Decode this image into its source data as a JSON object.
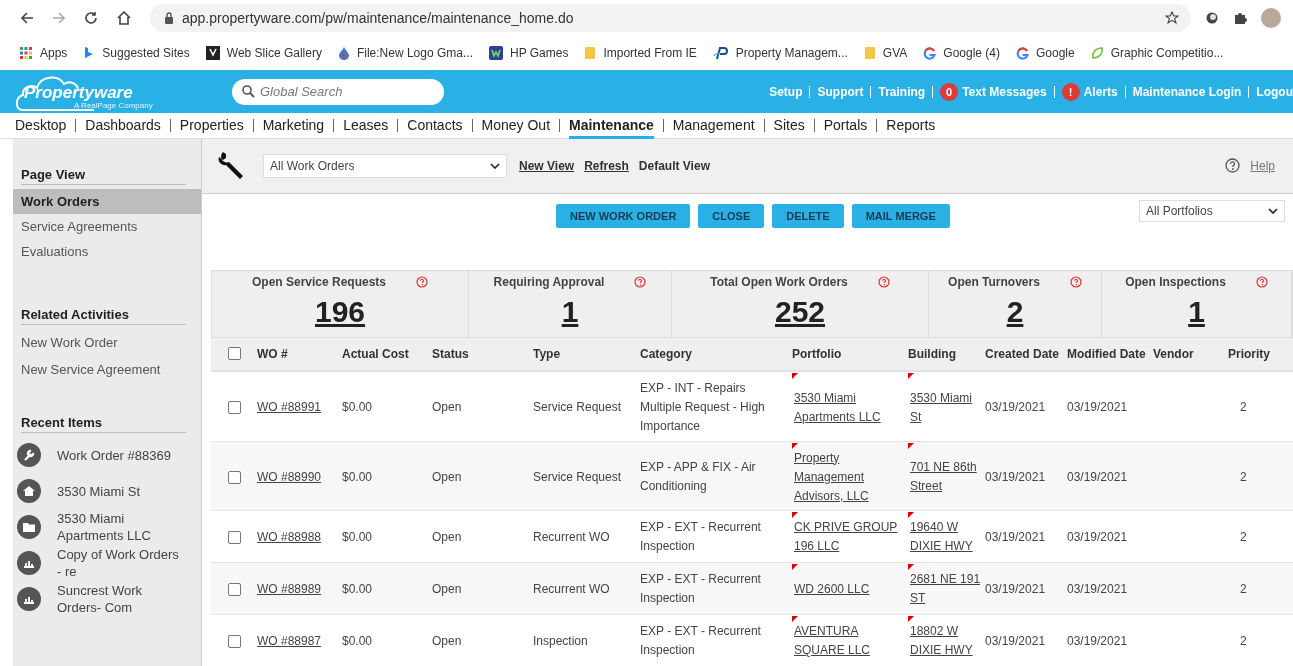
{
  "browser": {
    "url": "app.propertyware.com/pw/maintenance/maintenance_home.do",
    "bookmarks": [
      {
        "label": "Apps",
        "kind": "grid"
      },
      {
        "label": "Suggested Sites",
        "kind": "bing"
      },
      {
        "label": "Web Slice Gallery",
        "kind": "slice"
      },
      {
        "label": "File:New Logo Gma...",
        "kind": "drop"
      },
      {
        "label": "HP Games",
        "kind": "game"
      },
      {
        "label": "Imported From IE",
        "kind": "folder"
      },
      {
        "label": "Property Managem...",
        "kind": "p"
      },
      {
        "label": "GVA",
        "kind": "folder"
      },
      {
        "label": "Google (4)",
        "kind": "google"
      },
      {
        "label": "Google",
        "kind": "google"
      },
      {
        "label": "Graphic Competitio...",
        "kind": "leaf"
      }
    ]
  },
  "header": {
    "logo": "Propertyware",
    "tagline": "A RealPage Company",
    "search": {
      "placeholder": "Global Search"
    },
    "links": [
      {
        "label": "Setup"
      },
      {
        "label": "Support"
      },
      {
        "label": "Training"
      },
      {
        "label": "Text Messages",
        "badge": "0"
      },
      {
        "label": "Alerts",
        "badge": "!"
      },
      {
        "label": "Maintenance Login"
      },
      {
        "label": "Logou"
      }
    ]
  },
  "nav": [
    {
      "label": "Desktop",
      "selected": false
    },
    {
      "label": "Dashboards",
      "selected": false
    },
    {
      "label": "Properties",
      "selected": false
    },
    {
      "label": "Marketing",
      "selected": false
    },
    {
      "label": "Leases",
      "selected": false
    },
    {
      "label": "Contacts",
      "selected": false
    },
    {
      "label": "Money Out",
      "selected": false
    },
    {
      "label": "Maintenance",
      "selected": true
    },
    {
      "label": "Management",
      "selected": false
    },
    {
      "label": "Sites",
      "selected": false
    },
    {
      "label": "Portals",
      "selected": false
    },
    {
      "label": "Reports",
      "selected": false
    }
  ],
  "sidebar": {
    "page_view": {
      "title": "Page View",
      "items": [
        {
          "label": "Work Orders",
          "selected": true
        },
        {
          "label": "Service Agreements",
          "selected": false
        },
        {
          "label": "Evaluations",
          "selected": false
        }
      ]
    },
    "related": {
      "title": "Related Activities",
      "items": [
        "New Work Order",
        "New Service Agreement"
      ]
    },
    "recent": {
      "title": "Recent Items",
      "items": [
        {
          "label": "Work Order #88369",
          "kind": "wrench"
        },
        {
          "label": "3530 Miami St",
          "kind": "house"
        },
        {
          "label": "3530 Miami Apartments LLC",
          "kind": "folder"
        },
        {
          "label": "Copy of Work Orders - re",
          "kind": "report"
        },
        {
          "label": "Suncrest Work Orders- Com",
          "kind": "report"
        }
      ]
    }
  },
  "toolbar": {
    "view": "All Work Orders",
    "links": [
      "New View",
      "Refresh"
    ],
    "default_view": "Default View",
    "help": "Help"
  },
  "buttons": [
    "NEW WORK ORDER",
    "CLOSE",
    "DELETE",
    "MAIL MERGE"
  ],
  "portfolio_filter": "All Portfolios",
  "stats": [
    {
      "label": "Open Service Requests",
      "value": "196"
    },
    {
      "label": "Requiring Approval",
      "value": "1"
    },
    {
      "label": "Total Open Work Orders",
      "value": "252"
    },
    {
      "label": "Open Turnovers",
      "value": "2"
    },
    {
      "label": "Open Inspections",
      "value": "1"
    }
  ],
  "table": {
    "select_all_checked": false,
    "columns": [
      "WO #",
      "Actual Cost",
      "Status",
      "Type",
      "Category",
      "Portfolio",
      "Building",
      "Created Date",
      "Modified Date",
      "Vendor",
      "Priority"
    ],
    "rows": [
      {
        "checked": false,
        "wo": "WO #88991",
        "cost": "$0.00",
        "status": "Open",
        "type": "Service Request",
        "category": "EXP - INT - Repairs Multiple Request - High Importance",
        "portfolio": "3530 Miami Apartments LLC",
        "building": "3530 Miami St",
        "created": "03/19/2021",
        "modified": "03/19/2021",
        "priority": "2"
      },
      {
        "checked": false,
        "wo": "WO #88990",
        "cost": "$0.00",
        "status": "Open",
        "type": "Service Request",
        "category": "EXP - APP & FIX - Air Conditioning",
        "portfolio": "Property Management Advisors, LLC",
        "building": "701 NE 86th Street",
        "created": "03/19/2021",
        "modified": "03/19/2021",
        "priority": "2"
      },
      {
        "checked": false,
        "wo": "WO #88988",
        "cost": "$0.00",
        "status": "Open",
        "type": "Recurrent WO",
        "category": "EXP - EXT - Recurrent Inspection",
        "portfolio": "CK PRIVE GROUP 196 LLC",
        "building": "19640 W DIXIE HWY",
        "created": "03/19/2021",
        "modified": "03/19/2021",
        "priority": "2"
      },
      {
        "checked": false,
        "wo": "WO #88989",
        "cost": "$0.00",
        "status": "Open",
        "type": "Recurrent WO",
        "category": "EXP - EXT - Recurrent Inspection",
        "portfolio": "WD 2600 LLC",
        "building": "2681 NE 191 ST",
        "created": "03/19/2021",
        "modified": "03/19/2021",
        "priority": "2"
      },
      {
        "checked": false,
        "wo": "WO #88987",
        "cost": "$0.00",
        "status": "Open",
        "type": "Inspection",
        "category": "EXP - EXT - Recurrent Inspection",
        "portfolio": "AVENTURA SQUARE LLC",
        "building": "18802 W DIXIE HWY",
        "created": "03/19/2021",
        "modified": "03/19/2021",
        "priority": "2"
      }
    ]
  }
}
